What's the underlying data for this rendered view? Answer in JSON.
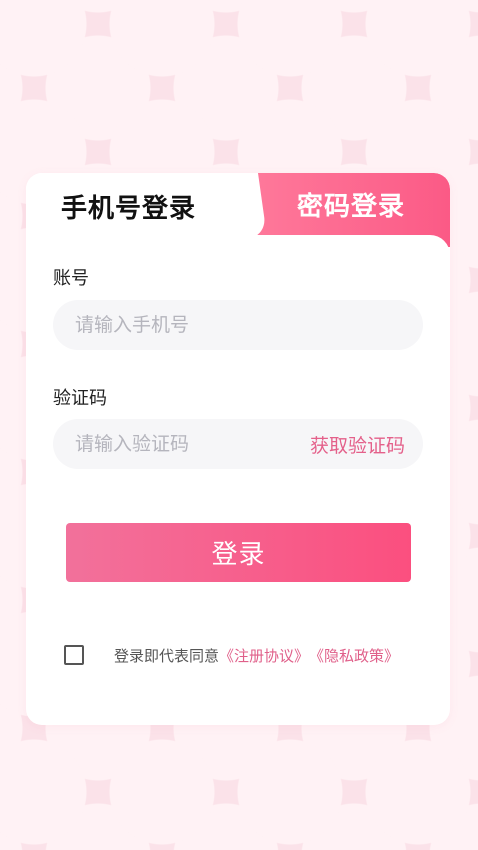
{
  "tabs": {
    "phone_login": "手机号登录",
    "password_login": "密码登录"
  },
  "form": {
    "account_label": "账号",
    "phone_placeholder": "请输入手机号",
    "code_label": "验证码",
    "code_placeholder": "请输入验证码",
    "get_code": "获取验证码",
    "login_button": "登录"
  },
  "agreement": {
    "prefix": "登录即代表同意",
    "terms": "《注册协议》",
    "privacy": "《隐私政策》"
  },
  "colors": {
    "accent": "#fb5a86",
    "link": "#e0608a",
    "background": "#fbe2e9"
  }
}
